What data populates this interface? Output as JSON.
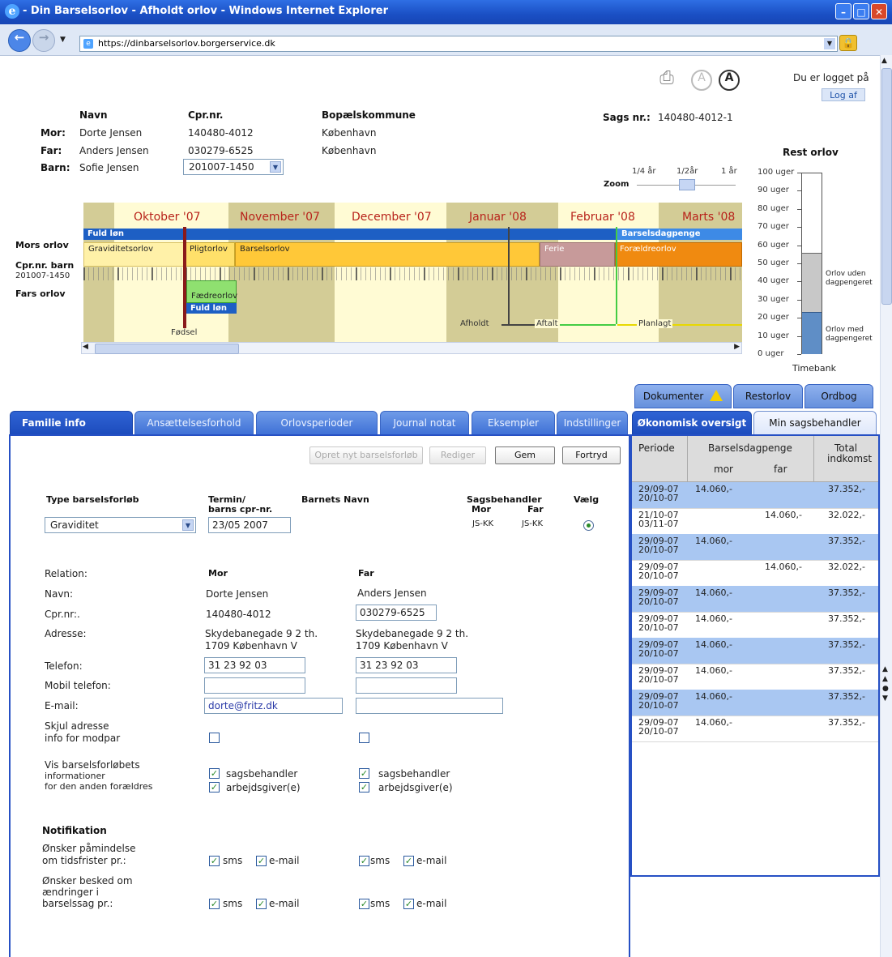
{
  "window": {
    "title": "- Din Barselsorlov - Afholdt orlov - Windows Internet Explorer",
    "url": "https://dinbarselsorlov.borgerservice.dk"
  },
  "header": {
    "logged_in": "Du er logget på",
    "logout": "Log af",
    "col_name": "Navn",
    "col_cpr": "Cpr.nr.",
    "col_kommune": "Bopælskommune",
    "mor_label": "Mor:",
    "mor_name": "Dorte Jensen",
    "mor_cpr": "140480-4012",
    "mor_kommune": "København",
    "far_label": "Far:",
    "far_name": "Anders Jensen",
    "far_cpr": "030279-6525",
    "far_kommune": "København",
    "barn_label": "Barn:",
    "barn_name": "Sofie Jensen",
    "barn_cpr": "201007-1450",
    "sags_label": "Sags nr.:",
    "sags_nr": "140480-4012-1",
    "text_small": "A",
    "text_large": "A"
  },
  "timeline": {
    "zoom_label": "Zoom",
    "zoom_opts": [
      "1/4 år",
      "1/2år",
      "1 år"
    ],
    "months": [
      "Oktober '07",
      "November '07",
      "December '07",
      "Januar '08",
      "Februar '08",
      "Marts '08"
    ],
    "row_mor": "Mors orlov",
    "row_barn1": "Cpr.nr. barn",
    "row_barn2": "201007-1450",
    "row_far": "Fars orlov",
    "bars": {
      "fuld_lon": "Fuld løn",
      "barselsdagpenge": "Barselsdagpenge",
      "graviditet": "Graviditetsorlov",
      "pligt": "Pligtorlov",
      "barsel": "Barselsorlov",
      "ferie": "Ferie",
      "foraeldre": "Forældreorlov",
      "faedre": "Fædreorlov",
      "fuld_lon_far": "Fuld løn"
    },
    "markers": {
      "fodsel": "Fødsel",
      "afholdt": "Afholdt",
      "aftalt": "Aftalt",
      "planlagt": "Planlagt"
    }
  },
  "rest": {
    "title": "Rest orlov",
    "ticks": [
      "100 uger",
      "90 uger",
      "80 uger",
      "70 uger",
      "60 uger",
      "50 uger",
      "40 uger",
      "30 uger",
      "20 uger",
      "10 uger",
      "0 uger"
    ],
    "uden": "Orlov uden dagpengeret",
    "med": "Orlov med dagpengeret",
    "timebank": "Timebank",
    "uden_weeks": 33,
    "med_weeks": 23
  },
  "tabs": {
    "left": [
      "Familie info",
      "Ansættelsesforhold",
      "Orlovsperioder",
      "Journal notat",
      "Eksempler",
      "Indstillinger"
    ],
    "right_top": [
      "Dokumenter",
      "Restorlov",
      "Ordbog"
    ],
    "right_bottom": [
      "Økonomisk oversigt",
      "Min sagsbehandler"
    ]
  },
  "form": {
    "btn_opret": "Opret nyt barselsforløb",
    "btn_rediger": "Rediger",
    "btn_gem": "Gem",
    "btn_fortryd": "Fortryd",
    "h_type": "Type barselsforløb",
    "h_termin1": "Termin/",
    "h_termin2": "barns cpr-nr.",
    "h_navn": "Barnets Navn",
    "h_sags": "Sagsbehandler",
    "h_mor": "Mor",
    "h_far": "Far",
    "h_vaelg": "Vælg",
    "type_value": "Graviditet",
    "termin_value": "23/05 2007",
    "sags_mor": "JS-KK",
    "sags_far": "JS-KK",
    "relation": "Relation:",
    "navn": "Navn:",
    "cpr": "Cpr.nr:.",
    "adresse": "Adresse:",
    "telefon": "Telefon:",
    "mobil": "Mobil telefon:",
    "email": "E-mail:",
    "skjul1": "Skjul adresse",
    "skjul2": "info for modpar",
    "vis1": "Vis barselsforløbets",
    "vis2": "informationer",
    "vis3": "for den anden forældres",
    "mor": {
      "rel": "Mor",
      "navn": "Dorte Jensen",
      "cpr": "140480-4012",
      "adr1": "Skydebanegade 9 2 th.",
      "adr2": "1709 København V",
      "tlf": "31 23 92 03",
      "mobil": "",
      "email": "dorte@fritz.dk"
    },
    "far": {
      "rel": "Far",
      "navn": "Anders Jensen",
      "cpr": "030279-6525",
      "adr1": "Skydebanegade 9 2 th.",
      "adr2": "1709 København V",
      "tlf": "31 23 92 03",
      "mobil": "",
      "email": ""
    },
    "opt_sags": "sagsbehandler",
    "opt_arb": "arbejdsgiver(e)",
    "notif": "Notifikation",
    "p1a": "Ønsker påmindelse",
    "p1b": "om tidsfrister pr.:",
    "p2a": "Ønsker besked om",
    "p2b": "ændringer i",
    "p2c": "barselssag pr.:",
    "sms": "sms",
    "email_opt": "e-mail"
  },
  "oekonomi": {
    "h_periode": "Periode",
    "h_barsel": "Barselsdagpenge",
    "h_mor": "mor",
    "h_far": "far",
    "h_total1": "Total",
    "h_total2": "indkomst",
    "rows": [
      {
        "p1": "29/09-07",
        "p2": "20/10-07",
        "mor": "14.060,-",
        "far": "",
        "total": "37.352,-",
        "hl": true
      },
      {
        "p1": "21/10-07",
        "p2": "03/11-07",
        "mor": "",
        "far": "14.060,-",
        "total": "32.022,-",
        "hl": false
      },
      {
        "p1": "29/09-07",
        "p2": "20/10-07",
        "mor": "14.060,-",
        "far": "",
        "total": "37.352,-",
        "hl": true
      },
      {
        "p1": "29/09-07",
        "p2": "20/10-07",
        "mor": "",
        "far": "14.060,-",
        "total": "32.022,-",
        "hl": false
      },
      {
        "p1": "29/09-07",
        "p2": "20/10-07",
        "mor": "14.060,-",
        "far": "",
        "total": "37.352,-",
        "hl": true
      },
      {
        "p1": "29/09-07",
        "p2": "20/10-07",
        "mor": "14.060,-",
        "far": "",
        "total": "37.352,-",
        "hl": false
      },
      {
        "p1": "29/09-07",
        "p2": "20/10-07",
        "mor": "14.060,-",
        "far": "",
        "total": "37.352,-",
        "hl": true
      },
      {
        "p1": "29/09-07",
        "p2": "20/10-07",
        "mor": "14.060,-",
        "far": "",
        "total": "37.352,-",
        "hl": false
      },
      {
        "p1": "29/09-07",
        "p2": "20/10-07",
        "mor": "14.060,-",
        "far": "",
        "total": "37.352,-",
        "hl": true
      },
      {
        "p1": "29/09-07",
        "p2": "20/10-07",
        "mor": "14.060,-",
        "far": "",
        "total": "37.352,-",
        "hl": false
      }
    ]
  }
}
